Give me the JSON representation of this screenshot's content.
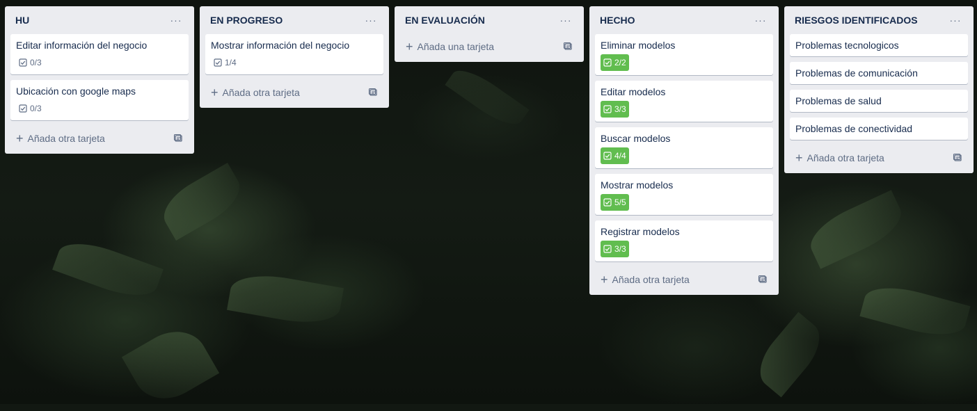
{
  "lists": [
    {
      "title": "HU",
      "cards": [
        {
          "title": "Editar información del negocio",
          "badge": "0/3",
          "complete": false
        },
        {
          "title": "Ubicación con google maps",
          "badge": "0/3",
          "complete": false
        }
      ],
      "add_label": "Añada otra tarjeta"
    },
    {
      "title": "EN PROGRESO",
      "cards": [
        {
          "title": "Mostrar información del negocio",
          "badge": "1/4",
          "complete": false
        }
      ],
      "add_label": "Añada otra tarjeta"
    },
    {
      "title": "EN EVALUACIÓN",
      "cards": [],
      "add_label": "Añada una tarjeta"
    },
    {
      "title": "HECHO",
      "cards": [
        {
          "title": "Eliminar modelos",
          "badge": "2/2",
          "complete": true
        },
        {
          "title": "Editar modelos",
          "badge": "3/3",
          "complete": true
        },
        {
          "title": "Buscar modelos",
          "badge": "4/4",
          "complete": true
        },
        {
          "title": "Mostrar modelos",
          "badge": "5/5",
          "complete": true
        },
        {
          "title": "Registrar modelos",
          "badge": "3/3",
          "complete": true
        }
      ],
      "add_label": "Añada otra tarjeta"
    },
    {
      "title": "RIESGOS IDENTIFICADOS",
      "cards": [
        {
          "title": "Problemas tecnologicos"
        },
        {
          "title": "Problemas de comunicación"
        },
        {
          "title": "Problemas de salud"
        },
        {
          "title": "Problemas de conectividad"
        }
      ],
      "add_label": "Añada otra tarjeta"
    }
  ],
  "icons": {
    "menu": "more-horizontal-icon",
    "checklist": "checklist-icon",
    "add": "plus-icon",
    "template": "card-template-icon"
  },
  "colors": {
    "list_bg": "#ebecf0",
    "card_bg": "#ffffff",
    "complete_badge": "#61bd4f",
    "text": "#172b4d",
    "muted": "#5e6c84"
  }
}
